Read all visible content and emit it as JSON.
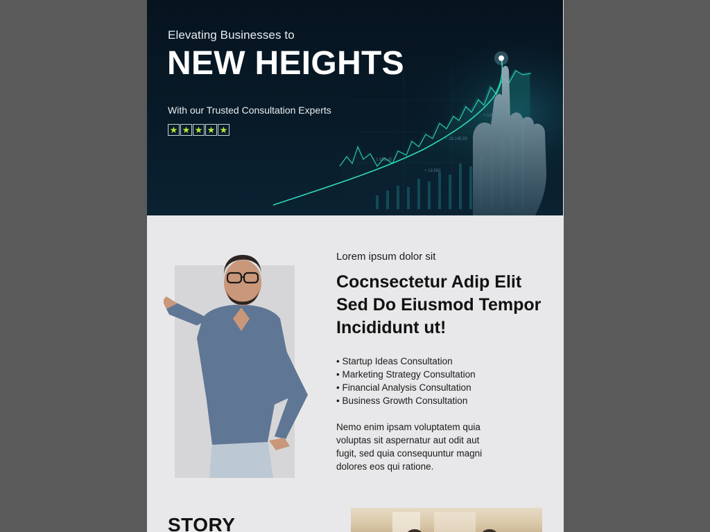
{
  "hero": {
    "eyebrow": "Elevating Businesses to",
    "title": "NEW HEIGHTS",
    "subtitle": "With our Trusted Consultation Experts",
    "rating": 5,
    "accent_color": "#2fd9b8",
    "star_color": "#b4ea38"
  },
  "content": {
    "eyebrow": "Lorem ipsum dolor sit",
    "headline": "Cocnsectetur Adip Elit Sed Do Eiusmod Tempor Incididunt ut!",
    "services": [
      "Startup Ideas Consultation",
      "Marketing Strategy Consultation",
      "Financial Analysis Consultation",
      "Business Growth Consultation"
    ],
    "body": "Nemo enim ipsam voluptatem quia voluptas sit aspernatur aut odit aut fugit, sed quia consequuntur magni dolores eos qui ratione."
  },
  "story": {
    "title": "STORY"
  }
}
